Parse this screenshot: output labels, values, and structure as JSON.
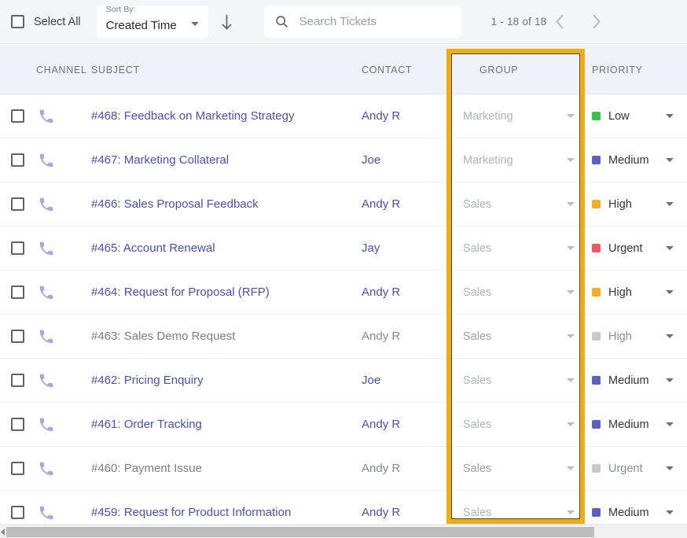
{
  "toolbar": {
    "select_all_label": "Select All",
    "sort_by_label": "Sort By:",
    "sort_by_value": "Created Time",
    "sort_direction_icon": "arrow-down-icon",
    "search_placeholder": "Search Tickets",
    "search_value": "",
    "search_icon": "search-icon",
    "pagination_text": "1 - 18 of 18",
    "prev_icon": "chevron-left-icon",
    "next_icon": "chevron-right-icon"
  },
  "table": {
    "headers": {
      "channel": "CHANNEL",
      "subject": "SUBJECT",
      "contact": "CONTACT",
      "group": "GROUP",
      "priority": "PRIORITY"
    },
    "highlighted_column": "GROUP",
    "highlight_color": "#edad15",
    "priority_colors": {
      "Low": "#3cc14b",
      "Medium": "#5c61bb",
      "High": "#f2ad27",
      "Urgent": "#f05765",
      "read": "#c7c9ce"
    },
    "rows": [
      {
        "subject": "#468: Feedback on Marketing Strategy",
        "contact": "Andy R",
        "group": "Marketing",
        "priority": "Low",
        "channel_icon": "phone-icon",
        "read": false
      },
      {
        "subject": "#467: Marketing Collateral",
        "contact": "Joe",
        "group": "Marketing",
        "priority": "Medium",
        "channel_icon": "phone-icon",
        "read": false
      },
      {
        "subject": "#466: Sales Proposal Feedback",
        "contact": "Andy R",
        "group": "Sales",
        "priority": "High",
        "channel_icon": "phone-icon",
        "read": false
      },
      {
        "subject": "#465: Account Renewal",
        "contact": "Jay",
        "group": "Sales",
        "priority": "Urgent",
        "channel_icon": "phone-icon",
        "read": false
      },
      {
        "subject": "#464: Request for Proposal (RFP)",
        "contact": "Andy R",
        "group": "Sales",
        "priority": "High",
        "channel_icon": "phone-icon",
        "read": false
      },
      {
        "subject": "#463: Sales Demo Request",
        "contact": "Andy R",
        "group": "Sales",
        "priority": "High",
        "channel_icon": "phone-icon",
        "read": true
      },
      {
        "subject": "#462: Pricing Enquiry",
        "contact": "Joe",
        "group": "Sales",
        "priority": "Medium",
        "channel_icon": "phone-icon",
        "read": false
      },
      {
        "subject": "#461: Order Tracking",
        "contact": "Andy R",
        "group": "Sales",
        "priority": "Medium",
        "channel_icon": "phone-icon",
        "read": false
      },
      {
        "subject": "#460: Payment Issue",
        "contact": "Andy R",
        "group": "Sales",
        "priority": "Urgent",
        "channel_icon": "phone-icon",
        "read": true
      },
      {
        "subject": "#459: Request for Product Information",
        "contact": "Andy R",
        "group": "Sales",
        "priority": "Medium",
        "channel_icon": "phone-icon",
        "read": false
      }
    ]
  }
}
